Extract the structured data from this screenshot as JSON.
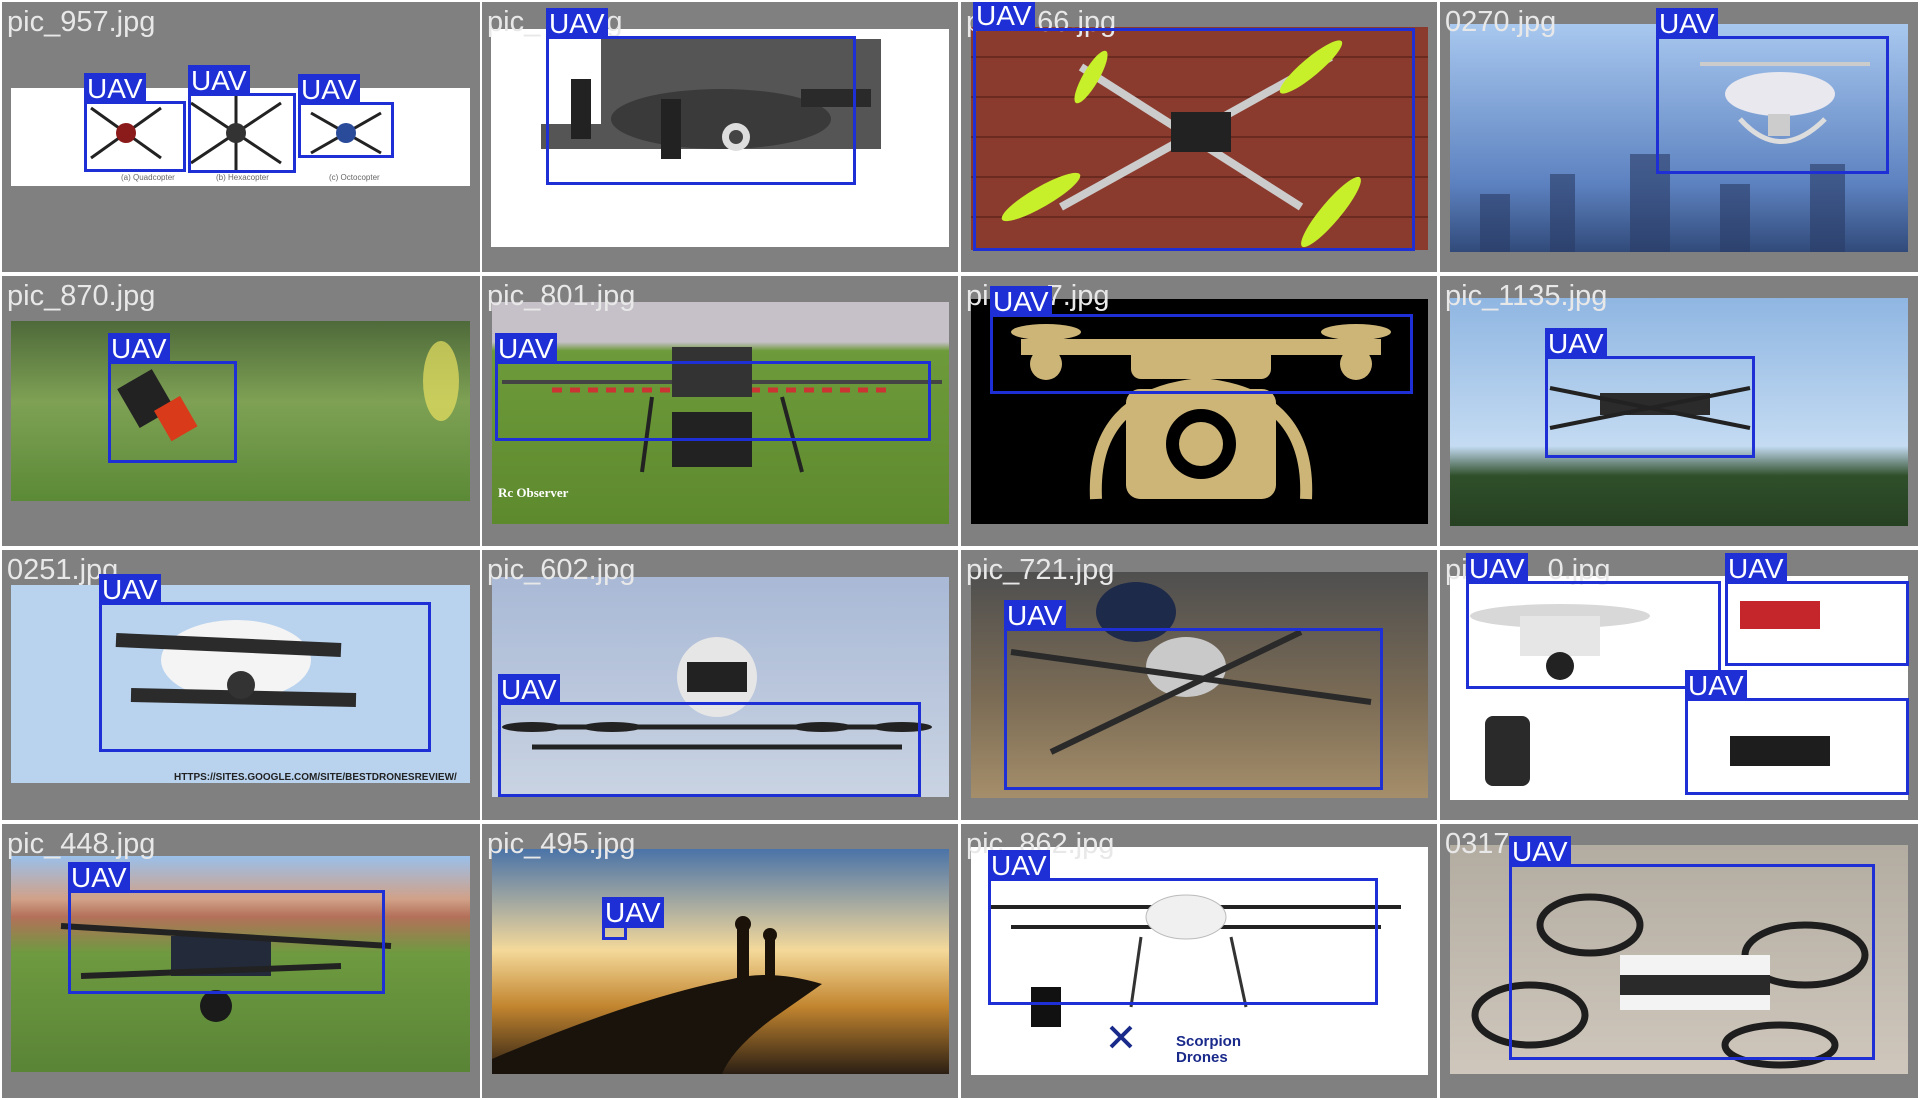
{
  "grid": {
    "columns": 4,
    "rows": 4,
    "cell_background": "#808080",
    "box_color": "#1e2fd6"
  },
  "tiles": [
    {
      "filename": "pic_957.jpg",
      "detections": [
        {
          "label": "UAV"
        },
        {
          "label": "UAV"
        },
        {
          "label": "UAV"
        }
      ]
    },
    {
      "filename": "pic_",
      "filename_suffix": "pg",
      "detections": [
        {
          "label": "UAV"
        }
      ]
    },
    {
      "filename": "p",
      "filename_suffix": "66.jpg",
      "detections": [
        {
          "label": "UAV"
        }
      ]
    },
    {
      "filename": "0270.jpg",
      "detections": [
        {
          "label": "UAV"
        }
      ]
    },
    {
      "filename": "pic_870.jpg",
      "detections": [
        {
          "label": "UAV"
        }
      ]
    },
    {
      "filename": "pic_801.jpg",
      "caption": "Rc Observer",
      "detections": [
        {
          "label": "UAV"
        }
      ]
    },
    {
      "filename": "pi",
      "filename_suffix": "7.jpg",
      "detections": [
        {
          "label": "UAV"
        }
      ]
    },
    {
      "filename": "pic_1135.jpg",
      "detections": [
        {
          "label": "UAV"
        }
      ]
    },
    {
      "filename": "0251.jpg",
      "caption": "HTTPS://SITES.GOOGLE.COM/SITE/BESTDRONESREVIEW/",
      "detections": [
        {
          "label": "UAV"
        }
      ]
    },
    {
      "filename": "pic_602.jpg",
      "detections": [
        {
          "label": "UAV"
        }
      ]
    },
    {
      "filename": "pic_721.jpg",
      "detections": [
        {
          "label": "UAV"
        }
      ]
    },
    {
      "filename": "pi",
      "filename_suffix": "0.jpg",
      "detections": [
        {
          "label": "UAV"
        },
        {
          "label": "UAV"
        },
        {
          "label": "UAV"
        }
      ]
    },
    {
      "filename": "pic_448.jpg",
      "detections": [
        {
          "label": "UAV"
        }
      ]
    },
    {
      "filename": "pic_495.jpg",
      "detections": [
        {
          "label": "UAV"
        }
      ]
    },
    {
      "filename": "pic_862.jpg",
      "caption": "Scorpion Drones",
      "detections": [
        {
          "label": "UAV"
        }
      ]
    },
    {
      "filename": "0317",
      "detections": [
        {
          "label": "UAV"
        }
      ]
    }
  ]
}
